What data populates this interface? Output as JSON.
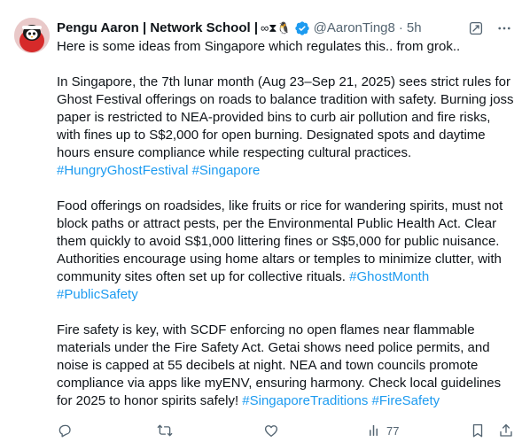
{
  "author": {
    "display_name": "Pengu Aaron | Network School |",
    "name_emojis": "∞⧗🐧",
    "handle": "@AaronTing8",
    "separator": "·",
    "time": "5h"
  },
  "tweet": {
    "intro": "Here is some ideas from Singapore which regulates this.. from grok..",
    "p1": "In Singapore, the 7th lunar month (Aug 23–Sep 21, 2025) sees strict rules for Ghost Festival offerings on roads to balance tradition with safety. Burning joss paper is restricted to NEA-provided bins to curb air pollution and fire risks, with fines up to S$2,000 for open burning. Designated spots and daytime hours ensure compliance while respecting cultural practices.",
    "p1_tags": [
      "#HungryGhostFestival",
      "#Singapore"
    ],
    "p2": "Food offerings on roadsides, like fruits or rice for wandering spirits, must not block paths or attract pests, per the Environmental Public Health Act. Clear them quickly to avoid S$1,000 littering fines or S$5,000 for public nuisance. Authorities encourage using home altars or temples to minimize clutter, with community sites often set up for collective rituals.",
    "p2_tags": [
      "#GhostMonth",
      "#PublicSafety"
    ],
    "p3": "Fire safety is key, with SCDF enforcing no open flames near flammable materials under the Fire Safety Act. Getai shows need police permits, and noise is capped at 55 decibels at night. NEA and town councils promote compliance via apps like myENV, ensuring harmony. Check local guidelines for 2025 to honor spirits safely!",
    "p3_tags": [
      "#SingaporeTraditions",
      "#FireSafety"
    ]
  },
  "actions": {
    "views_count": "77"
  },
  "colors": {
    "text": "#0f1419",
    "secondary": "#536471",
    "link": "#1d9bf0",
    "verified": "#1d9bf0"
  },
  "icons": [
    "grok-icon",
    "more-icon",
    "reply-icon",
    "retweet-icon",
    "like-icon",
    "views-icon",
    "bookmark-icon",
    "share-icon",
    "verified-badge-icon"
  ]
}
